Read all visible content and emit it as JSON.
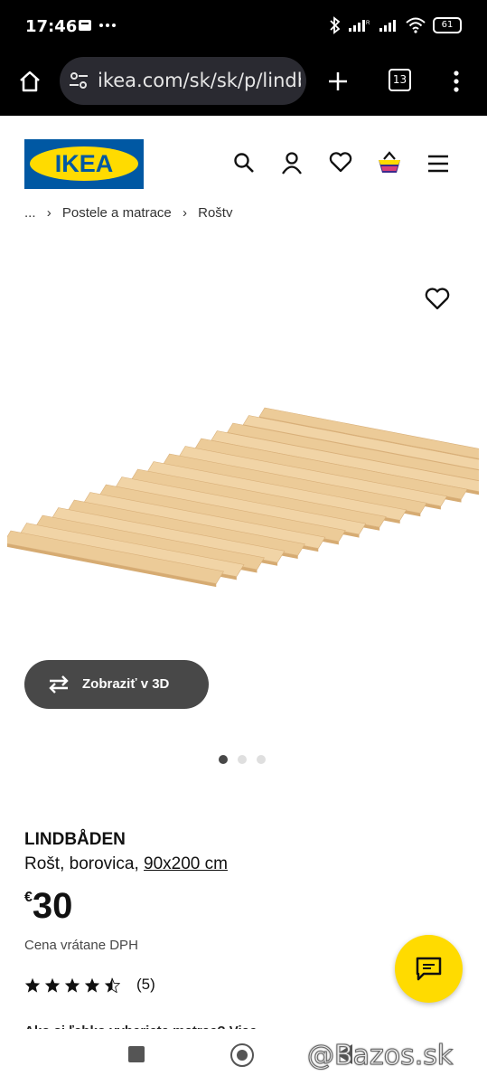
{
  "status_bar": {
    "time": "17:46",
    "battery": "61"
  },
  "browser": {
    "url": "ikea.com/sk/sk/p/lindbaden",
    "tab_count": "13"
  },
  "header": {
    "logo_text": "IKEA",
    "brand_blue": "#0058a3",
    "brand_yellow": "#ffdb00"
  },
  "breadcrumb": {
    "items": [
      "...",
      "Postele a matrace",
      "Rošty"
    ]
  },
  "gallery": {
    "view_3d_label": "Zobraziť v 3D",
    "image_count": 3,
    "active_index": 0
  },
  "product": {
    "name": "LINDBÅDEN",
    "description": "Rošt, borovica,",
    "size": "90x200 cm",
    "currency": "€",
    "price": "30",
    "vat_note": "Cena vrátane DPH",
    "rating": 4.5,
    "review_count": "(5)"
  },
  "partial_text": "Ako si ľahko vyberiete matrac? Viac informácií",
  "watermark": "@Bazos.sk"
}
